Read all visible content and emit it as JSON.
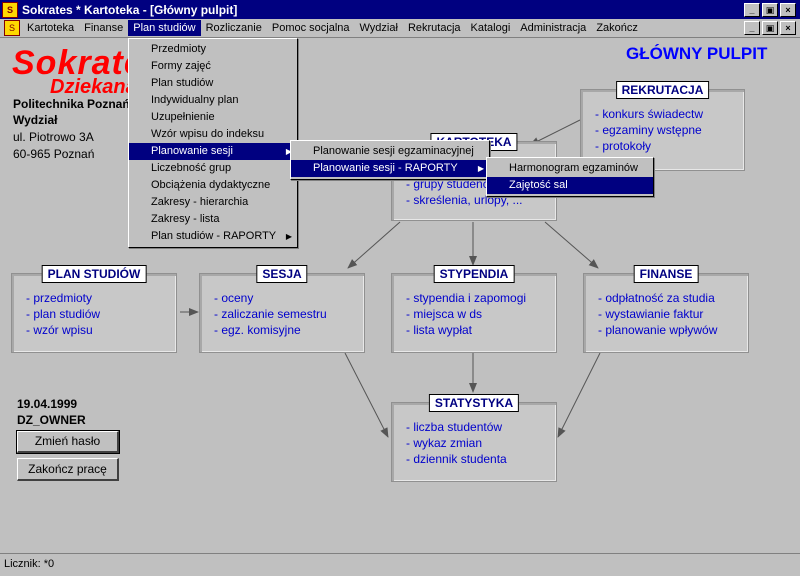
{
  "window": {
    "title": "Sokrates * Kartoteka - [Główny pulpit]",
    "minimize": "_",
    "maximize": "▣",
    "close": "×"
  },
  "menubar": {
    "items": [
      "Kartoteka",
      "Finanse",
      "Plan studiów",
      "Rozliczanie",
      "Pomoc socjalna",
      "Wydział",
      "Rekrutacja",
      "Katalogi",
      "Administracja",
      "Zakończ"
    ]
  },
  "logo": {
    "line1": "Sokrates",
    "line2": "Dziekanat"
  },
  "info": {
    "org": "Politechnika Poznańska",
    "dept": "Wydział",
    "street": "ul. Piotrowo 3A",
    "city": "60-965 Poznań",
    "date": "19.04.1999",
    "user": "DZ_OWNER"
  },
  "buttons": {
    "change_password": "Zmień hasło",
    "end_work": "Zakończ pracę"
  },
  "main_title": "GŁÓWNY PULPIT",
  "boxes": {
    "kartoteka": {
      "title": "KARTOTEKA",
      "items": [
        "- grupy studenckie",
        "- skreślenia, urlopy, ..."
      ]
    },
    "rekrutacja": {
      "title": "REKRUTACJA",
      "items": [
        "- konkurs świadectw",
        "- egzaminy wstępne",
        "- protokoły"
      ]
    },
    "plan": {
      "title": "PLAN STUDIÓW",
      "items": [
        "- przedmioty",
        "- plan studiów",
        "- wzór wpisu"
      ]
    },
    "sesja": {
      "title": "SESJA",
      "items": [
        "- oceny",
        "- zaliczanie semestru",
        "- egz. komisyjne"
      ]
    },
    "stypendia": {
      "title": "STYPENDIA",
      "items": [
        "- stypendia i zapomogi",
        "- miejsca w ds",
        "- lista wypłat"
      ]
    },
    "finanse": {
      "title": "FINANSE",
      "items": [
        "- odpłatność za studia",
        "- wystawianie faktur",
        "- planowanie wpływów"
      ]
    },
    "statystyka": {
      "title": "STATYSTYKA",
      "items": [
        "- liczba studentów",
        "- wykaz zmian",
        "- dziennik studenta"
      ]
    }
  },
  "menu_plan": {
    "items": [
      "Przedmioty",
      "Formy zajęć",
      "Plan studiów",
      "Indywidualny plan",
      "Uzupełnienie",
      "Wzór wpisu do indeksu",
      "Planowanie sesji",
      "Liczebność grup",
      "Obciążenia dydaktyczne",
      "Zakresy - hierarchia",
      "Zakresy - lista",
      "Plan studiów - RAPORTY"
    ]
  },
  "menu_sesja": {
    "items": [
      "Planowanie sesji egzaminacyjnej",
      "Planowanie sesji - RAPORTY"
    ]
  },
  "menu_raporty": {
    "items": [
      "Harmonogram egzaminów",
      "Zajętość sal"
    ]
  },
  "status": "Licznik: *0",
  "colors": {
    "titlebar": "#000080",
    "accent_text": "#0000cc",
    "logo": "#ff0000"
  }
}
